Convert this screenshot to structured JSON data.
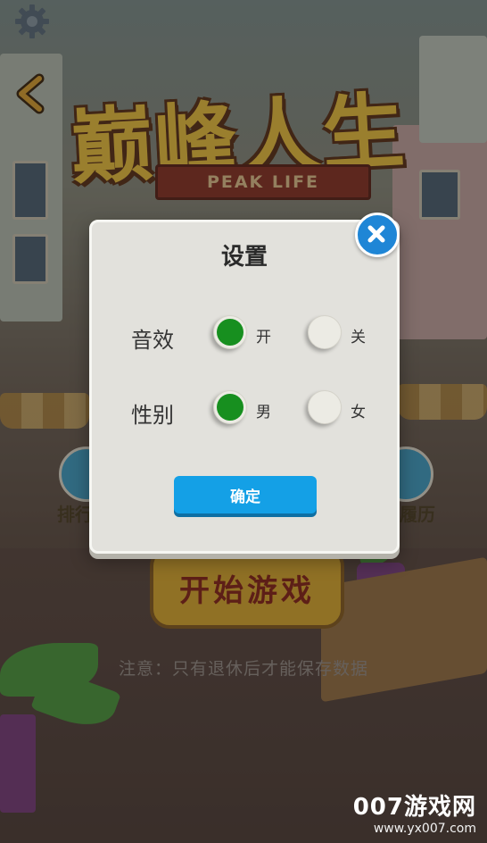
{
  "logo": {
    "title": "巅峰人生",
    "subtitle": "PEAK LIFE"
  },
  "background": {
    "rank_label": "排行",
    "resume_label": "履历",
    "start_button": "开始游戏",
    "notice": "注意：只有退休后才能保存数据"
  },
  "dialog": {
    "title": "设置",
    "rows": [
      {
        "label": "音效",
        "option_a": "开",
        "option_b": "关",
        "selected": "开"
      },
      {
        "label": "性别",
        "option_a": "男",
        "option_b": "女",
        "selected": "男"
      }
    ],
    "confirm_label": "确定"
  },
  "watermark": {
    "main": "007游戏网",
    "url": "www.yx007.com"
  },
  "colors": {
    "accent_blue": "#14a0e6",
    "selected_green": "#178f1f",
    "dialog_bg": "#e2e1dc"
  },
  "icons": [
    "gear-icon",
    "back-arrow-icon",
    "close-icon"
  ]
}
